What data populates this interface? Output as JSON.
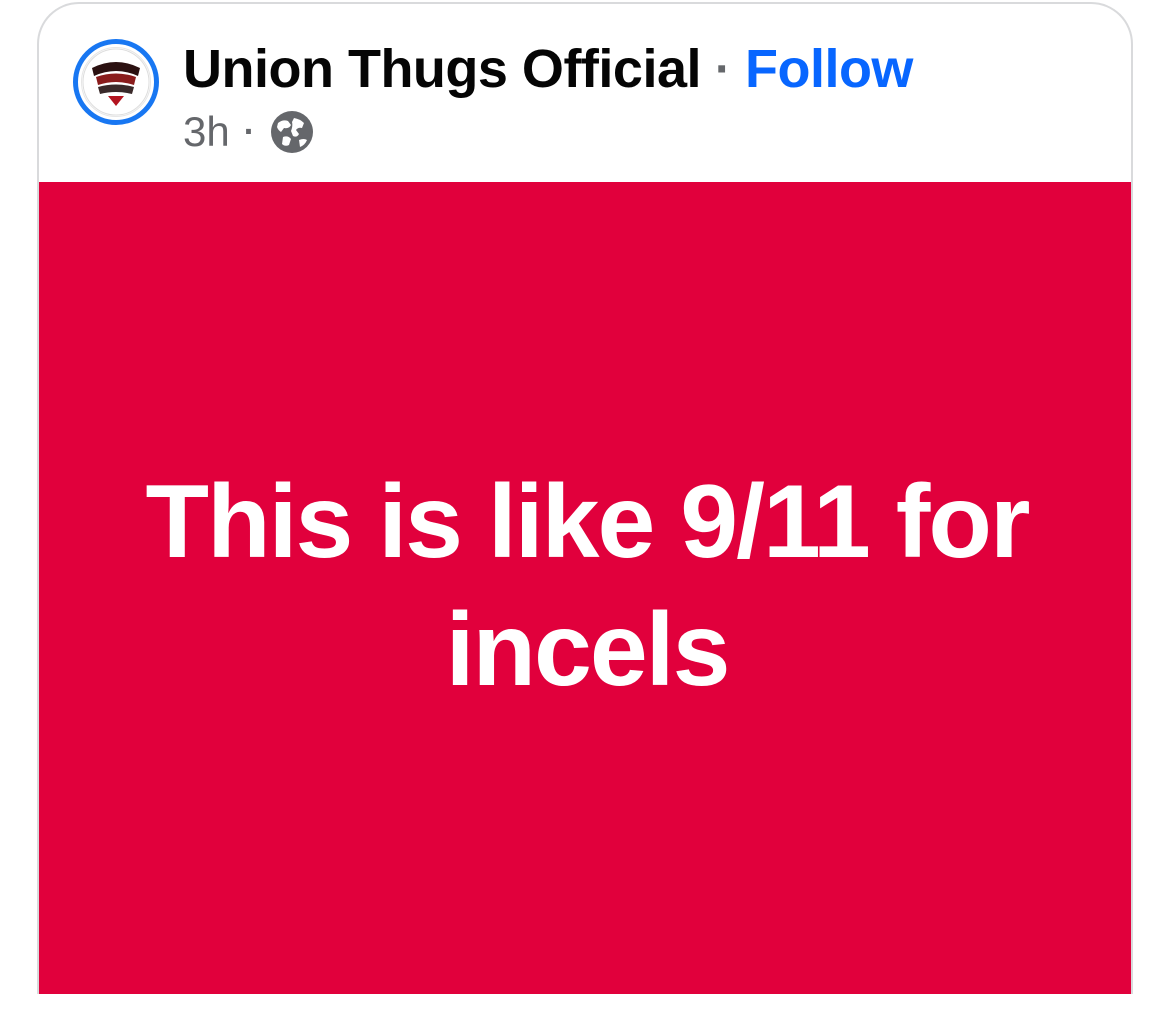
{
  "post": {
    "page_name": "Union Thugs Official",
    "separator": "·",
    "follow_label": "Follow",
    "timestamp": "3h",
    "meta_separator": "·",
    "audience_icon": "globe-icon",
    "avatar_icon": "page-logo",
    "text": "This is like 9/11 for incels",
    "background_color": "#e1003c",
    "follow_color": "#0866ff",
    "avatar_ring_color": "#1877f2"
  }
}
